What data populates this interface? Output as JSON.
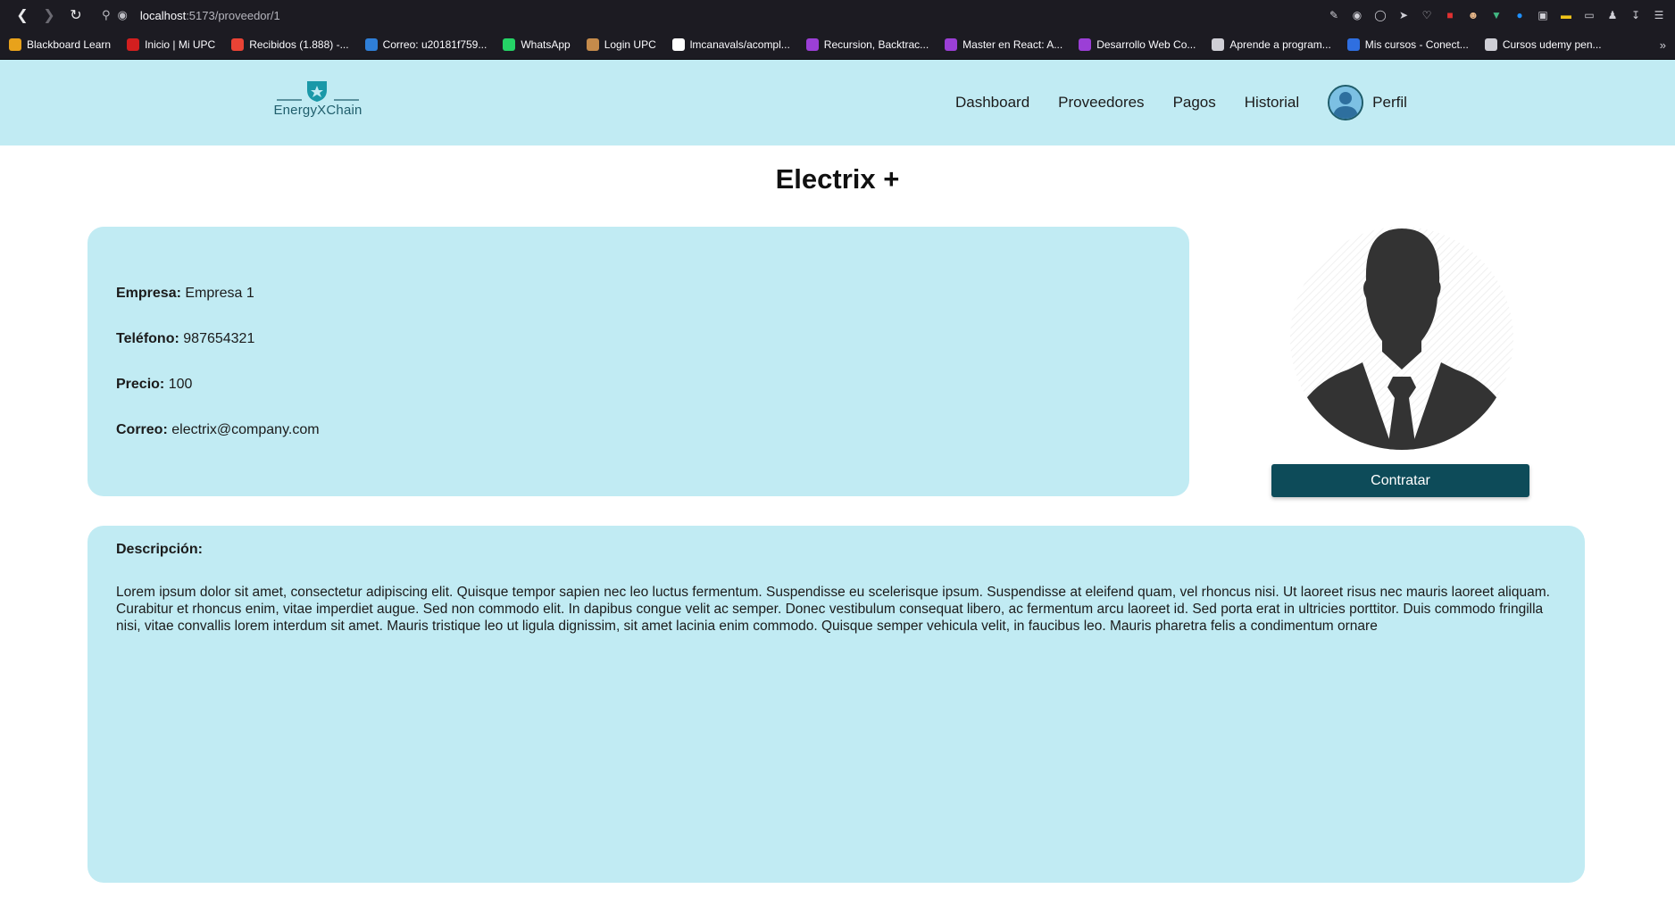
{
  "browser": {
    "url_host": "localhost",
    "url_path": ":5173/proveedor/1",
    "bookmarks": [
      {
        "label": "Blackboard Learn",
        "color": "#e8a21b"
      },
      {
        "label": "Inicio | Mi UPC",
        "color": "#d21f1f"
      },
      {
        "label": "Recibidos (1.888) -...",
        "color": "#ea4335"
      },
      {
        "label": "Correo: u20181f759...",
        "color": "#2f7fd8"
      },
      {
        "label": "WhatsApp",
        "color": "#25d366"
      },
      {
        "label": "Login UPC",
        "color": "#c58b4b"
      },
      {
        "label": "lmcanavals/acompl...",
        "color": "#ffffff"
      },
      {
        "label": "Recursion, Backtrac...",
        "color": "#9b3fd6"
      },
      {
        "label": "Master en React: A...",
        "color": "#9b3fd6"
      },
      {
        "label": "Desarrollo Web Co...",
        "color": "#9b3fd6"
      },
      {
        "label": "Aprende a program...",
        "color": "#cfcfd6"
      },
      {
        "label": "Mis cursos - Conect...",
        "color": "#2f6fe0"
      },
      {
        "label": "Cursos udemy pen...",
        "color": "#cfcfd6"
      }
    ],
    "more_icon": "chevron-double-right-icon"
  },
  "header": {
    "logo_text": "EnergyXChain",
    "nav": [
      {
        "label": "Dashboard"
      },
      {
        "label": "Proveedores"
      },
      {
        "label": "Pagos"
      },
      {
        "label": "Historial"
      }
    ],
    "profile_label": "Perfil"
  },
  "provider": {
    "name": "Electrix +",
    "fields": [
      {
        "label": "Empresa:",
        "value": "Empresa 1"
      },
      {
        "label": "Teléfono:",
        "value": "987654321"
      },
      {
        "label": "Precio:",
        "value": "100"
      },
      {
        "label": "Correo:",
        "value": "electrix@company.com"
      }
    ],
    "hire_label": "Contratar",
    "description_label": "Descripción:",
    "description": "Lorem ipsum dolor sit amet, consectetur adipiscing elit. Quisque tempor sapien nec leo luctus fermentum. Suspendisse eu scelerisque ipsum. Suspendisse at eleifend quam, vel rhoncus nisi. Ut laoreet risus nec mauris laoreet aliquam. Curabitur et rhoncus enim, vitae imperdiet augue. Sed non commodo elit. In dapibus congue velit ac semper. Donec vestibulum consequat libero, ac fermentum arcu laoreet id. Sed porta erat in ultricies porttitor. Duis commodo fringilla nisi, vitae convallis lorem interdum sit amet. Mauris tristique leo ut ligula dignissim, sit amet lacinia enim commodo. Quisque semper vehicula velit, in faucibus leo. Mauris pharetra felis a condimentum ornare"
  },
  "colors": {
    "header_bg": "#c1ebf3",
    "card_bg": "#c1ebf3",
    "button_bg": "#0d4b59",
    "chrome_bg": "#1c1b22"
  }
}
